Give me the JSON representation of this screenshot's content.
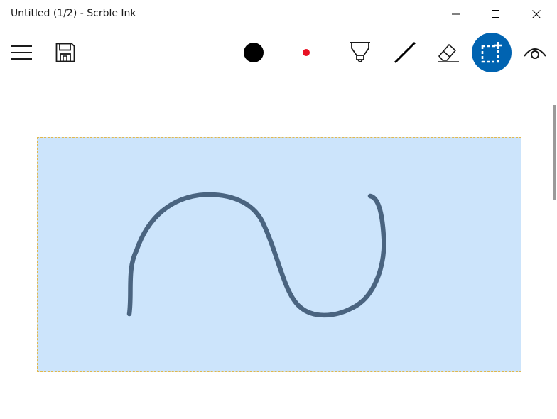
{
  "window": {
    "title": "Untitled (1/2) - Scrble Ink"
  },
  "titlebar_buttons": [
    {
      "name": "minimize-button",
      "icon": "minimize-icon"
    },
    {
      "name": "maximize-button",
      "icon": "maximize-icon"
    },
    {
      "name": "close-button",
      "icon": "close-icon"
    }
  ],
  "toolbar": {
    "tools": [
      {
        "name": "menu-button",
        "icon": "hamburger-menu-icon"
      },
      {
        "name": "save-button",
        "icon": "save-icon"
      },
      {
        "name": "pen-size-button",
        "icon": "brush-size-icon"
      },
      {
        "name": "pen-color-button",
        "icon": "color-dot-icon"
      },
      {
        "name": "highlighter-button",
        "icon": "highlighter-icon"
      },
      {
        "name": "line-tool-button",
        "icon": "line-icon"
      },
      {
        "name": "eraser-button",
        "icon": "eraser-icon"
      },
      {
        "name": "selection-tool-button",
        "icon": "selection-icon",
        "active": true
      },
      {
        "name": "view-button",
        "icon": "eye-icon"
      }
    ]
  },
  "colors": {
    "accent": "#0063b1",
    "selection_fill": "#cce4fb",
    "selection_border": "#e2b84c",
    "ink_stroke": "#4a6480",
    "pen_color": "#e81123"
  }
}
